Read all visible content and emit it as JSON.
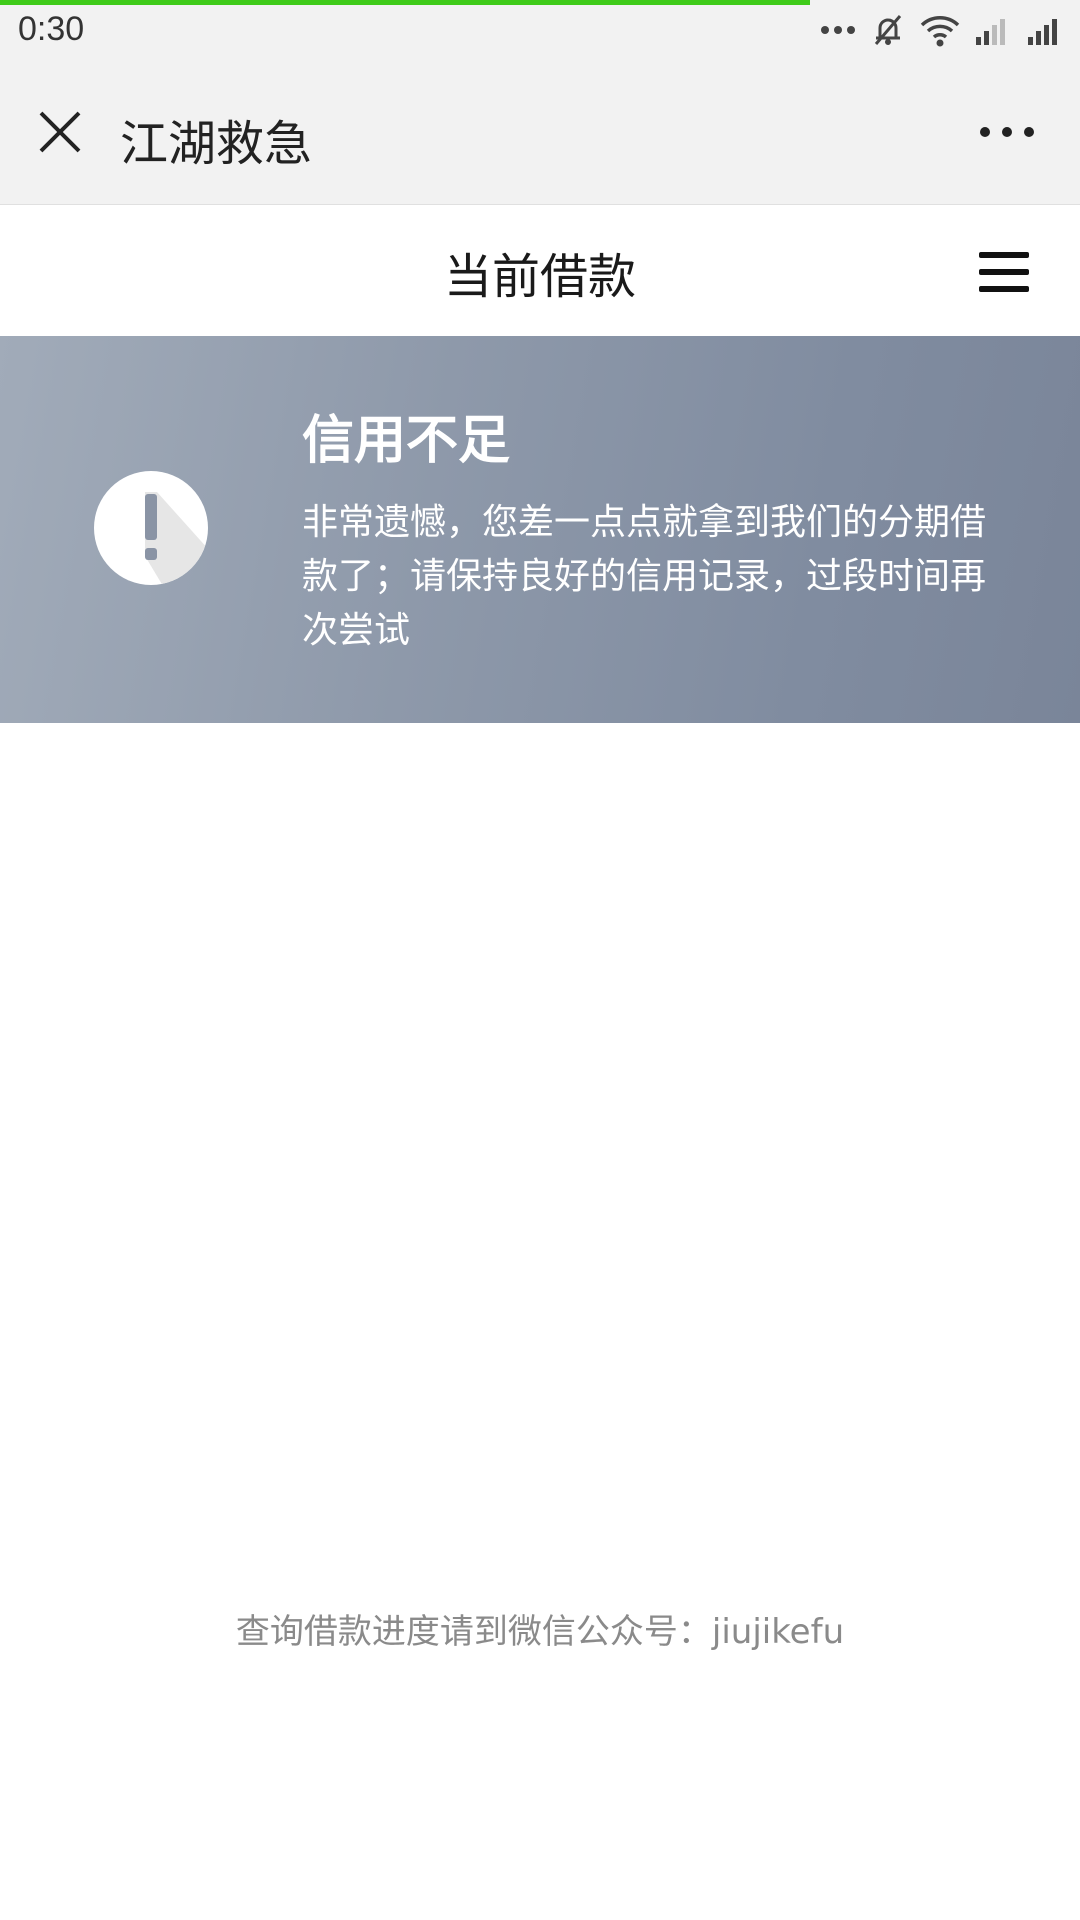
{
  "status_bar": {
    "time": "0:30",
    "icons": [
      "more-dots-icon",
      "mute-icon",
      "wifi-icon",
      "signal-weak-icon",
      "signal-full-icon"
    ]
  },
  "load_progress": 0.75,
  "title_bar": {
    "title": "江湖救急",
    "close_icon": "close-icon",
    "more_icon": "more-horizontal-icon"
  },
  "page_header": {
    "title": "当前借款",
    "menu_icon": "hamburger-menu-icon"
  },
  "banner": {
    "icon": "exclamation-circle-icon",
    "heading": "信用不足",
    "message": "非常遗憾，您差一点点就拿到我们的分期借款了；请保持良好的信用记录，过段时间再次尝试"
  },
  "footer": {
    "note": "查询借款进度请到微信公众号：jiujikefu"
  },
  "colors": {
    "progress": "#3fcb1a",
    "banner_start": "#a1abb9",
    "banner_end": "#7a8599",
    "bar_background": "#f2f2f2"
  }
}
